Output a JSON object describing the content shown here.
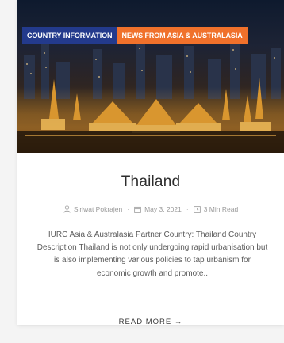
{
  "post": {
    "categories": [
      {
        "label": "COUNTRY INFORMATION",
        "color": "#233a8c"
      },
      {
        "label": "NEWS FROM ASIA & AUSTRALASIA",
        "color": "#f0712b"
      }
    ],
    "title": "Thailand",
    "author": "Siriwat Pokrajen",
    "date": "May 3, 2021",
    "read_time": "3 Min Read",
    "excerpt": "IURC Asia & Australasia Partner Country: Thailand Country Description Thailand is not only undergoing rapid urbanisation but is also implementing various policies to tap urbanism for economic growth and promote..",
    "read_more_label": "READ MORE",
    "read_more_icon": "arrow-right-icon"
  }
}
